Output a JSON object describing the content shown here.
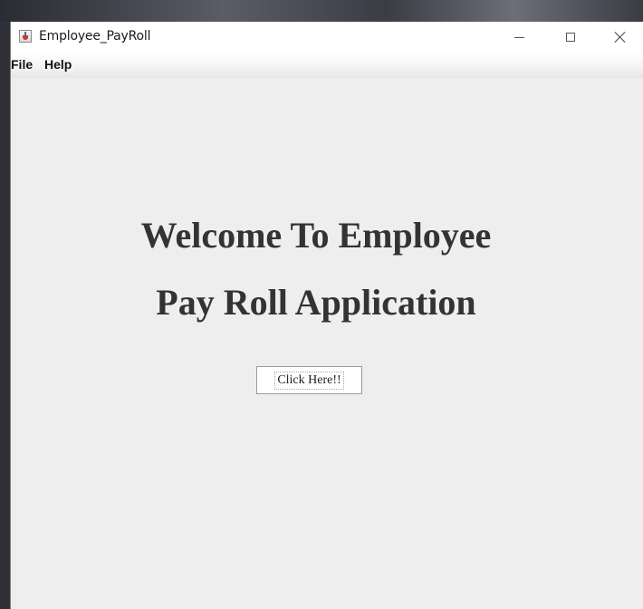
{
  "window": {
    "title": "Employee_PayRoll"
  },
  "menubar": {
    "items": [
      {
        "label": "File"
      },
      {
        "label": "Help"
      }
    ]
  },
  "main": {
    "headline_line1": "Welcome To Employee",
    "headline_line2": "Pay Roll Application",
    "cta_label": "Click Here!!"
  },
  "icons": {
    "app": "java-cup-icon",
    "minimize": "minimize-icon",
    "maximize": "maximize-icon",
    "close": "close-icon"
  },
  "colors": {
    "content_background": "#eeeeee",
    "headline_text": "#333333",
    "titlebar_background": "#ffffff"
  }
}
